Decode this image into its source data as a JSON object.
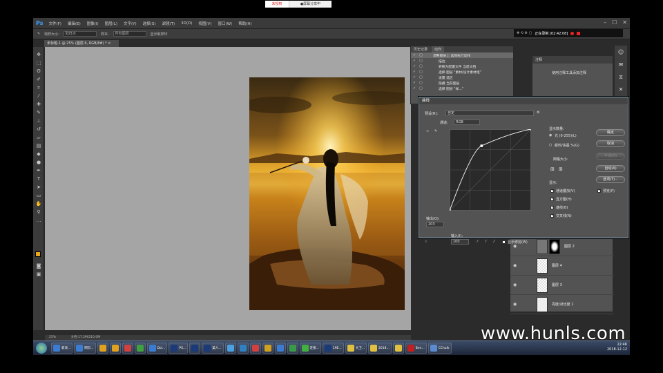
{
  "share_bar": {
    "left": "未授权",
    "right": "●屏幕分享中"
  },
  "menubar": {
    "logo": "Ps",
    "items": [
      "文件(F)",
      "编辑(E)",
      "图像(I)",
      "图层(L)",
      "文字(Y)",
      "选择(S)",
      "滤镜(T)",
      "3D(D)",
      "视图(V)",
      "窗口(W)",
      "帮助(H)"
    ],
    "window_controls": [
      "–",
      "☐",
      "✕"
    ]
  },
  "options_bar": {
    "sample_size_label": "取样大小:",
    "sample_size_value": "取样点",
    "sample_label": "样本:",
    "sample_value": "所有图层",
    "ring_label": "显示取样环"
  },
  "recording": {
    "text": "正在录制 [02:42:08]"
  },
  "doc_tab": {
    "label": "未标题-1 @ 25% (图层 6, RGB/8#) *  ×"
  },
  "actions_panel": {
    "tabs": [
      "历史记录",
      "动作"
    ],
    "rows": [
      "调整图层上 选择执行动作",
      "描边",
      "转换为配置文件 当前文档",
      "选择 图层 \"素材/设计素材组\"",
      "设置 选区",
      "隐藏 当前图层",
      "选择 图层 \"样…\""
    ]
  },
  "notes_panel": {
    "title": "注释",
    "text": "使用注释工具添加注释"
  },
  "curves": {
    "title": "曲线",
    "preset_label": "预设(R):",
    "preset_value": "自定",
    "channel_label": "通道:",
    "channel_value": "RGB",
    "output_label": "输出(O):",
    "output_value": "203",
    "input_label": "输入(I):",
    "input_value": "100",
    "show_clipping": "显示修剪(W)",
    "show_amount_title": "显示数量:",
    "light_option": "光 (0-255)(L)",
    "pigment_option": "颜料/油墨 %(G)",
    "grid_size_title": "网格大小:",
    "show_title": "显示:",
    "show_options": [
      "通道叠加(V)",
      "直方图(H)",
      "基线(B)",
      "交叉线(N)"
    ],
    "buttons": {
      "ok": "确定",
      "cancel": "取消",
      "smooth": "平滑(M)",
      "auto": "自动(A)",
      "options": "选项(T)..."
    },
    "preview_label": "预览(P)",
    "curve_points": [
      [
        0,
        0
      ],
      [
        100,
        203
      ],
      [
        255,
        255
      ]
    ]
  },
  "layers": {
    "rows": [
      {
        "name": "图层 2"
      },
      {
        "name": "图层 4"
      },
      {
        "name": "图层 3"
      },
      {
        "name": "亮度/对比度 1"
      }
    ]
  },
  "status": {
    "zoom": "25%",
    "doc": "文档:17.2M/210.0M"
  },
  "taskbar": {
    "items": [
      "新浪...",
      "网页...",
      "",
      "",
      "",
      "",
      "Dol...",
      "PS...",
      "",
      "美人...",
      "",
      "",
      "",
      "",
      "",
      "",
      "连接...",
      "19E...",
      "大卫...",
      "2018...",
      "",
      "Ben...",
      "CChalk"
    ],
    "clock_time": "22:46",
    "clock_date": "2018-12-12"
  },
  "watermark": "www.hunls.com"
}
